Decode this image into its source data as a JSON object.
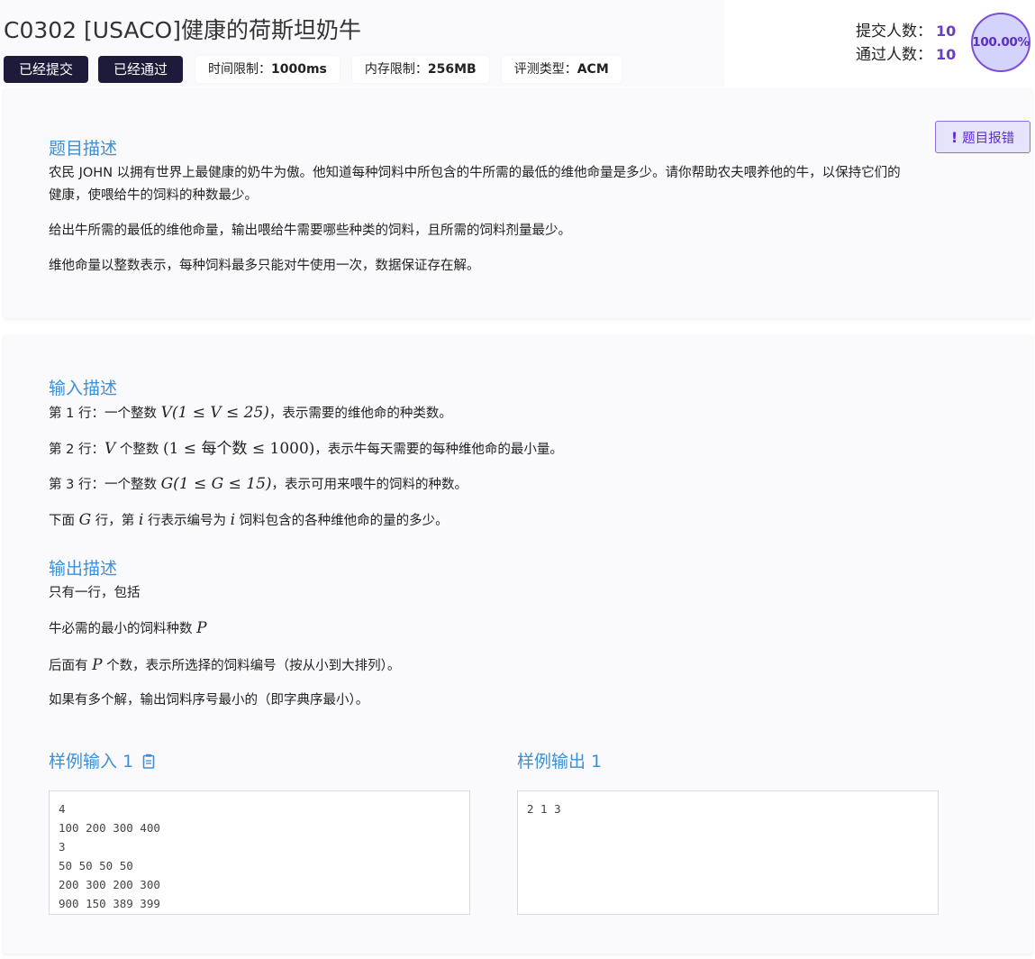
{
  "problem": {
    "title": "C0302 [USACO]健康的荷斯坦奶牛",
    "tags": {
      "submitted": "已经提交",
      "passed": "已经通过",
      "time_limit_label": "时间限制：",
      "time_limit_value": "1000ms",
      "memory_limit_label": "内存限制：",
      "memory_limit_value": "256MB",
      "judge_type_label": "评测类型：",
      "judge_type_value": "ACM"
    },
    "stats": {
      "submit_label": "提交人数：",
      "submit_count": "10",
      "pass_label": "通过人数：",
      "pass_count": "10",
      "pass_rate": "100.00%"
    },
    "report_button": "题目报错"
  },
  "description": {
    "heading": "题目描述",
    "lines": [
      "农民 JOHN 以拥有世界上最健康的奶牛为傲。他知道每种饲料中所包含的牛所需的最低的维他命量是多少。请你帮助农夫喂养他的牛，以保持它们的",
      "健康，使喂给牛的饲料的种数最少。",
      "给出牛所需的最低的维他命量，输出喂给牛需要哪些种类的饲料，且所需的饲料剂量最少。",
      "维他命量以整数表示，每种饲料最多只能对牛使用一次，数据保证存在解。"
    ]
  },
  "input": {
    "heading": "输入描述",
    "line1": {
      "pre": "第 1 行：一个整数 ",
      "math": "V(1 ≤ V ≤ 25)",
      "post": "，表示需要的维他命的种类数。"
    },
    "line2": {
      "pre": "第 2 行：",
      "var": "V",
      "mid": " 个整数 ",
      "math": "(1 ≤ 每个数 ≤ 1000)",
      "post": "，表示牛每天需要的每种维他命的最小量。"
    },
    "line3": {
      "pre": "第 3 行：一个整数 ",
      "math": "G(1 ≤ G ≤ 15)",
      "post": "，表示可用来喂牛的饲料的种数。"
    },
    "line4": {
      "pre": "下面 ",
      "var1": "G",
      "mid1": " 行，第 ",
      "var2": "i",
      "mid2": " 行表示编号为 ",
      "var3": "i",
      "post": " 饲料包含的各种维他命的量的多少。"
    }
  },
  "output": {
    "heading": "输出描述",
    "line1": "只有一行，包括",
    "line2": {
      "pre": "牛必需的最小的饲料种数 ",
      "var": "P"
    },
    "line3": {
      "pre": "后面有 ",
      "var": "P",
      "post": " 个数，表示所选择的饲料编号（按从小到大排列）。"
    },
    "line4": "如果有多个解，输出饲料序号最小的（即字典序最小）。"
  },
  "samples": {
    "input_title": "样例输入 1",
    "input_text": "4\n100 200 300 400\n3\n50 50 50 50\n200 300 200 300\n900 150 389 399",
    "output_title": "样例输出 1",
    "output_text": "2 1 3"
  },
  "icons": {
    "copy": "clipboard-icon",
    "report": "exclamation-icon"
  },
  "colors": {
    "accent_blue": "#3d8fd6",
    "accent_purple": "#6b3bc9",
    "tag_dark": "#1d1a3a"
  }
}
